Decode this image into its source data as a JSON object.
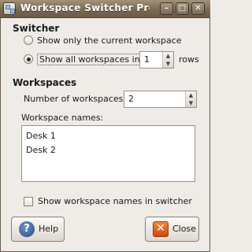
{
  "window": {
    "title": "Workspace Switcher Prefere",
    "minimize_glyph": "–",
    "maximize_glyph": "□",
    "close_glyph": "✕"
  },
  "switcher": {
    "heading": "Switcher",
    "option_current": "Show only the current workspace",
    "option_all": "Show all workspaces in:",
    "rows_value": "1",
    "rows_label": "rows",
    "selected": "all"
  },
  "workspaces": {
    "heading": "Workspaces",
    "count_label": "Number of workspaces:",
    "count_value": "2",
    "names_label": "Workspace names:",
    "names": [
      "Desk 1",
      "Desk 2"
    ],
    "show_names_label": "Show workspace names in switcher",
    "show_names_checked": false
  },
  "buttons": {
    "help": "Help",
    "close": "Close"
  },
  "icons": {
    "window_icon": "workspace-switcher-icon",
    "help_icon": "help-icon",
    "close_icon": "close-icon"
  }
}
